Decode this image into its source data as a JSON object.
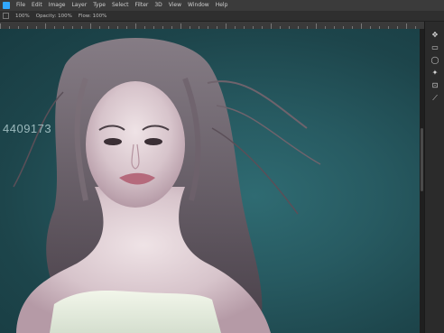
{
  "menubar": {
    "items": [
      "File",
      "Edit",
      "Image",
      "Layer",
      "Type",
      "Select",
      "Filter",
      "3D",
      "View",
      "Window",
      "Help"
    ]
  },
  "options": {
    "items": [
      "100%",
      "Opacity: 100%",
      "Flow: 100%"
    ]
  },
  "canvas": {
    "watermark_text": "4409173",
    "colors": {
      "background": "#275a61",
      "ui_dark": "#2b2b2b",
      "accent": "#31a8ff"
    }
  },
  "sidebar": {
    "tools": [
      "move-tool-icon",
      "marquee-tool-icon",
      "lasso-tool-icon",
      "magic-wand-icon",
      "crop-tool-icon",
      "eyedropper-icon"
    ]
  }
}
